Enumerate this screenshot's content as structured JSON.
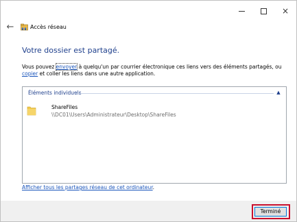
{
  "window": {
    "title": "Accès réseau",
    "buttons": {
      "minimize": "minimize-icon",
      "maximize": "maximize-icon",
      "close": "×"
    },
    "back": "←"
  },
  "main": {
    "heading": "Votre dossier est partagé.",
    "description": {
      "part1": "Vous pouvez ",
      "link_send": "envoyer",
      "part2": " à quelqu'un par courrier électronique ces liens vers des éléments partagés, ou ",
      "link_copy": "copier",
      "part3": " et coller les liens dans une autre application."
    },
    "list": {
      "group_title": "Éléments individuels",
      "chevron": "▲",
      "items": [
        {
          "name": "ShareFiles",
          "path": "\\\\DC01\\Users\\Administrateur\\Desktop\\ShareFiles"
        }
      ]
    },
    "footer_link": "Afficher tous les partages réseau de cet ordinateur",
    "footer_period": "."
  },
  "footer": {
    "done_label": "Terminé"
  },
  "colors": {
    "heading": "#1e3f8c",
    "link": "#1a55bb",
    "highlight": "#c8102e",
    "button_border": "#0078d7"
  }
}
